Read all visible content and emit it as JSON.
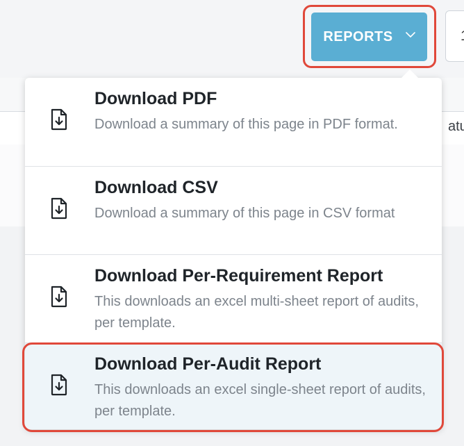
{
  "header": {
    "reports_label": "REPORTS",
    "next_button_label": "1"
  },
  "table": {
    "partial_header": "atu"
  },
  "reports_menu": {
    "items": [
      {
        "title": "Download PDF",
        "description": "Download a summary of this page in PDF format.",
        "icon": "file-download-icon"
      },
      {
        "title": "Download CSV",
        "description": "Download a summary of this page in CSV format",
        "icon": "file-download-icon"
      },
      {
        "title": "Download Per-Requirement Report",
        "description": "This downloads an excel multi-sheet report of audits, per template.",
        "icon": "file-download-icon"
      },
      {
        "title": "Download Per-Audit Report",
        "description": "This downloads an excel single-sheet report of audits, per template.",
        "icon": "file-download-icon",
        "highlighted": true
      }
    ]
  },
  "colors": {
    "accent": "#5aaed3",
    "highlight_outline": "#e0483a",
    "active_item_bg": "#eef5f9"
  }
}
